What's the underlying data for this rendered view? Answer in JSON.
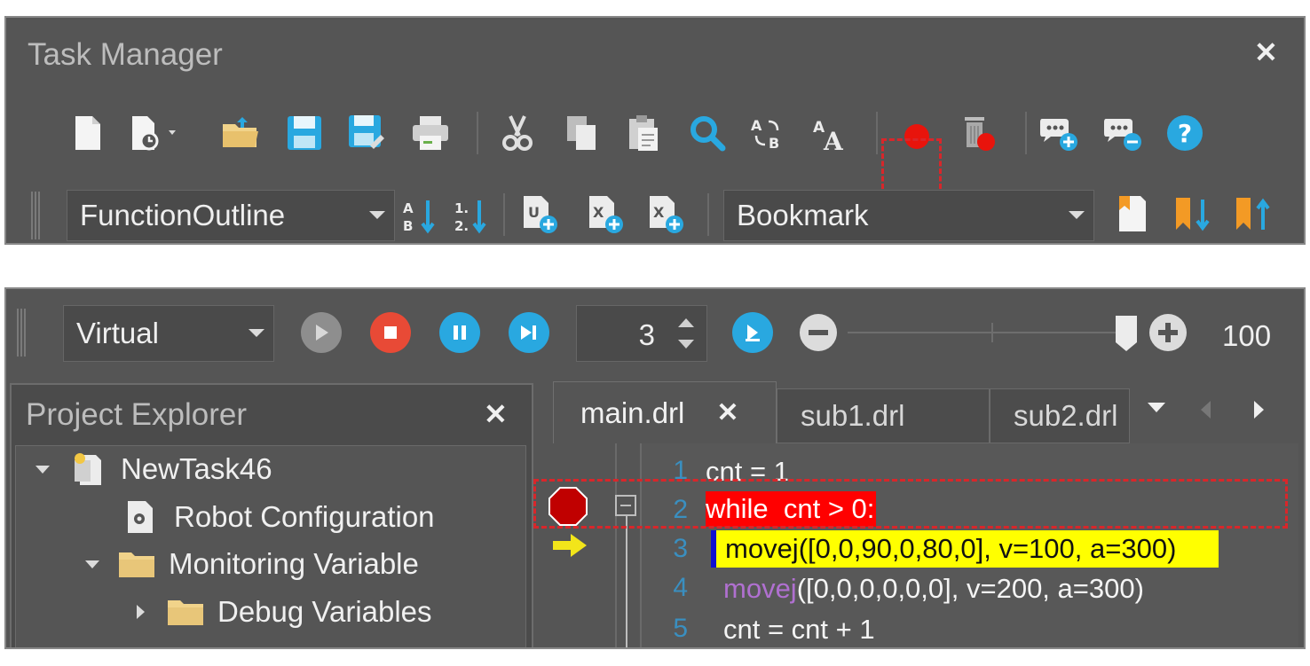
{
  "task_manager": {
    "title": "Task Manager",
    "function_combo": "FunctionOutline",
    "bookmark_combo": "Bookmark"
  },
  "run_toolbar": {
    "mode": "Virtual",
    "step_value": "3",
    "zoom_value": "100"
  },
  "project_explorer": {
    "title": "Project Explorer",
    "tree": [
      {
        "label": "NewTask46"
      },
      {
        "label": "Robot Configuration"
      },
      {
        "label": "Monitoring Variable"
      },
      {
        "label": "Debug Variables"
      }
    ]
  },
  "editor": {
    "tabs": [
      {
        "label": "main.drl"
      },
      {
        "label": "sub1.drl"
      },
      {
        "label": "sub2.drl"
      }
    ],
    "lines": [
      {
        "no": "1",
        "text": "cnt = 1"
      },
      {
        "no": "2",
        "text": "while  cnt > 0:"
      },
      {
        "no": "3",
        "text": "movej([0,0,90,0,80,0], v=100, a=300)"
      },
      {
        "no": "4",
        "keyword": "movej",
        "rest": "([0,0,0,0,0,0], v=200, a=300)"
      },
      {
        "no": "5",
        "text": "cnt = cnt + 1"
      }
    ]
  },
  "colors": {
    "panel_bg": "#555555",
    "highlight_dash": "#d9262a",
    "breakpoint": "#c00000",
    "current_line": "#ffff00",
    "breakpoint_line": "#ff0000",
    "keyword": "#b070d0",
    "line_number": "#3a8fc0",
    "accent_blue": "#29a8e0",
    "stop_red": "#e84a36"
  }
}
